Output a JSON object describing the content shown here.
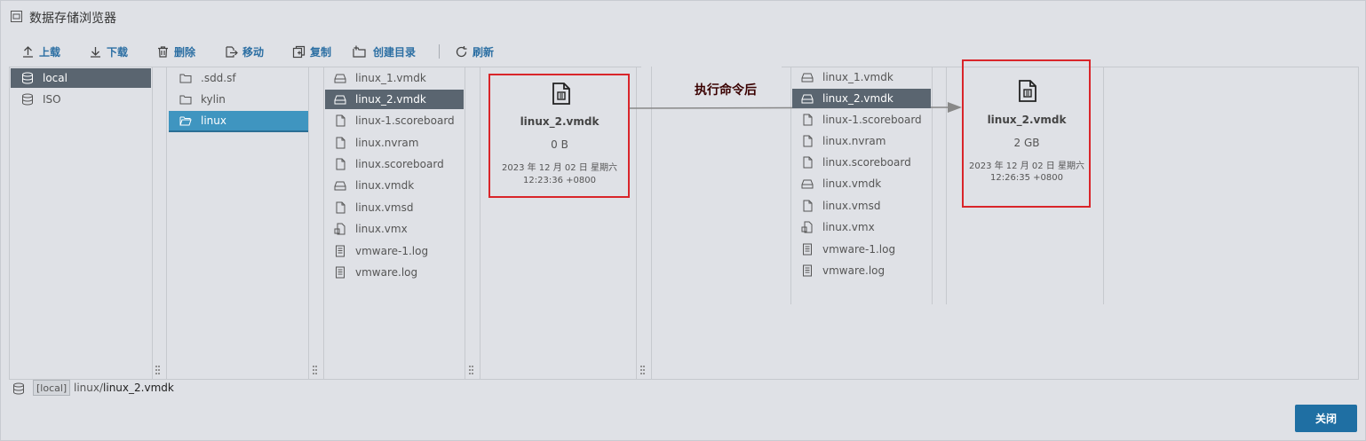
{
  "window": {
    "title": "数据存储浏览器"
  },
  "toolbar": {
    "upload": "上载",
    "download": "下载",
    "delete": "删除",
    "move": "移动",
    "copy": "复制",
    "create_dir": "创建目录",
    "refresh": "刷新"
  },
  "datastores": [
    "local",
    "ISO"
  ],
  "folders": [
    ".sdd.sf",
    "kylin",
    "linux"
  ],
  "files_left": [
    "linux_1.vmdk",
    "linux_2.vmdk",
    "linux-1.scoreboard",
    "linux.nvram",
    "linux.scoreboard",
    "linux.vmdk",
    "linux.vmsd",
    "linux.vmx",
    "vmware-1.log",
    "vmware.log"
  ],
  "files_right": [
    "linux_1.vmdk",
    "linux_2.vmdk",
    "linux-1.scoreboard",
    "linux.nvram",
    "linux.scoreboard",
    "linux.vmdk",
    "linux.vmsd",
    "linux.vmx",
    "vmware-1.log",
    "vmware.log"
  ],
  "detail_before": {
    "name": "linux_2.vmdk",
    "size": "0 B",
    "date": "2023 年 12 月 02 日 星期六",
    "time": "12:23:36 +0800"
  },
  "detail_after": {
    "name": "linux_2.vmdk",
    "size": "2 GB",
    "date": "2023 年 12 月 02 日 星期六",
    "time": "12:26:35 +0800"
  },
  "annotation": "执行命令后",
  "status": {
    "datastore_tag": "[local]",
    "path_prefix": "linux/",
    "path_file": "linux_2.vmdk"
  },
  "footer": {
    "close": "关闭"
  },
  "colors": {
    "accent": "#1f6fa3",
    "selected_gray": "#5a6570",
    "selected_blue": "#3f95c0",
    "highlight_box": "#d9252a"
  }
}
